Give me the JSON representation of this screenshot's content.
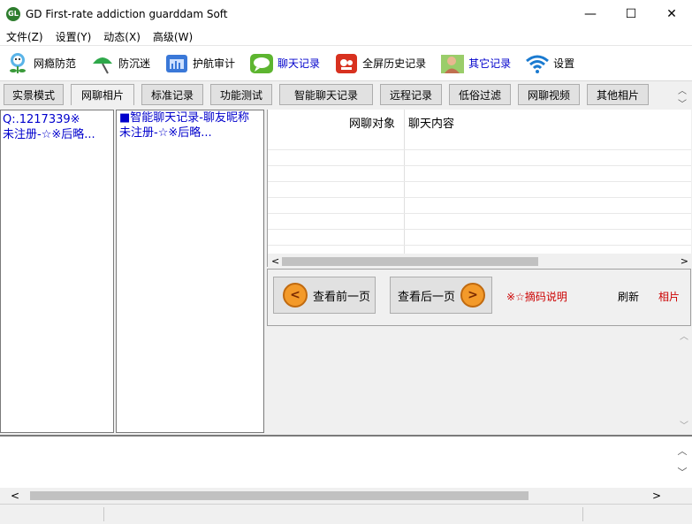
{
  "window": {
    "title": "GD First-rate addiction guarddam Soft",
    "minimize": "—",
    "maximize": "☐",
    "close": "✕"
  },
  "menu": [
    "文件(Z)",
    "设置(Y)",
    "动态(X)",
    "高级(W)"
  ],
  "toolbar": [
    {
      "label": "网瘾防范",
      "icon": "flower-icon",
      "blue": false
    },
    {
      "label": "防沉迷",
      "icon": "umbrella-icon",
      "blue": false
    },
    {
      "label": "护航审计",
      "icon": "monitor-chart-icon",
      "blue": false
    },
    {
      "label": "聊天记录",
      "icon": "chat-bubble-icon",
      "blue": true
    },
    {
      "label": "全屏历史记录",
      "icon": "camera-icon",
      "blue": false
    },
    {
      "label": "其它记录",
      "icon": "photo-person-icon",
      "blue": true
    },
    {
      "label": "设置",
      "icon": "wifi-icon",
      "blue": false
    }
  ],
  "tabs": [
    "实景模式",
    "网聊相片",
    "标准记录",
    "功能测试",
    "智能聊天记录",
    "远程记录",
    "低俗过滤",
    "网聊视频",
    "其他相片"
  ],
  "left_panel": {
    "line1": " Q:.1217339※",
    "line2": "未注册-☆※后略..."
  },
  "middle_panel": {
    "line1": "■智能聊天记录-聊友昵称",
    "line2": "未注册-☆※后略..."
  },
  "grid": {
    "col1": "网聊对象",
    "col2": "聊天内容"
  },
  "nav": {
    "prev": "查看前一页",
    "next": "查看后一页",
    "note": "※☆摘码说明",
    "refresh": "刷新",
    "photos": "相片"
  },
  "colors": {
    "accent_blue": "#0000cc",
    "note_red": "#cc0000",
    "circle_orange": "#f39a2a"
  }
}
